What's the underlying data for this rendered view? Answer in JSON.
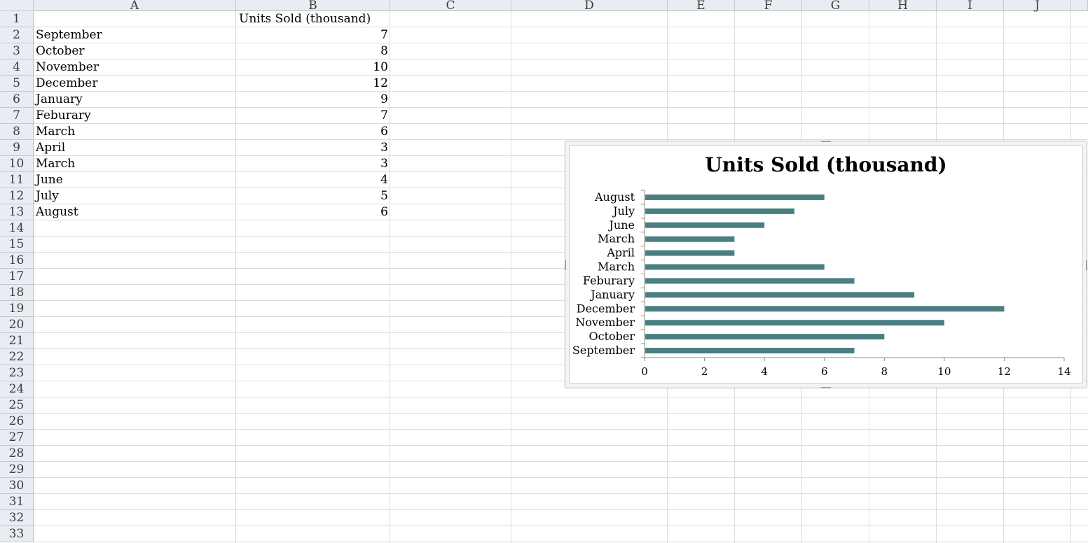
{
  "sheet": {
    "columns": [
      "A",
      "B",
      "C",
      "D",
      "E",
      "F",
      "G",
      "H",
      "I",
      "J"
    ],
    "rows": [
      "1",
      "2",
      "3",
      "4",
      "5",
      "6",
      "7",
      "8",
      "9",
      "10",
      "11",
      "12",
      "13",
      "14",
      "15",
      "16",
      "17",
      "18",
      "19",
      "20",
      "21",
      "22",
      "23",
      "24",
      "25",
      "26",
      "27",
      "28",
      "29",
      "30",
      "31",
      "32",
      "33"
    ],
    "header_b1": "Units Sold (thousand)",
    "data": [
      {
        "month": "September",
        "value": "7"
      },
      {
        "month": "October",
        "value": "8"
      },
      {
        "month": "November",
        "value": "10"
      },
      {
        "month": "December",
        "value": "12"
      },
      {
        "month": "January",
        "value": "9"
      },
      {
        "month": "Feburary",
        "value": "7"
      },
      {
        "month": "March",
        "value": "6"
      },
      {
        "month": "April",
        "value": "3"
      },
      {
        "month": "March",
        "value": "3"
      },
      {
        "month": "June",
        "value": "4"
      },
      {
        "month": "July",
        "value": "5"
      },
      {
        "month": "August",
        "value": "6"
      }
    ]
  },
  "chart_data": {
    "type": "bar",
    "orientation": "horizontal",
    "title": "Units Sold (thousand)",
    "categories": [
      "September",
      "October",
      "November",
      "December",
      "January",
      "Feburary",
      "March",
      "April",
      "March",
      "June",
      "July",
      "August"
    ],
    "values": [
      7,
      8,
      10,
      12,
      9,
      7,
      6,
      3,
      3,
      4,
      5,
      6
    ],
    "xlim": [
      0,
      14
    ],
    "xticks": [
      0,
      2,
      4,
      6,
      8,
      10,
      12,
      14
    ],
    "bar_color": "#4a7f82",
    "grid": false,
    "legend": "none"
  }
}
